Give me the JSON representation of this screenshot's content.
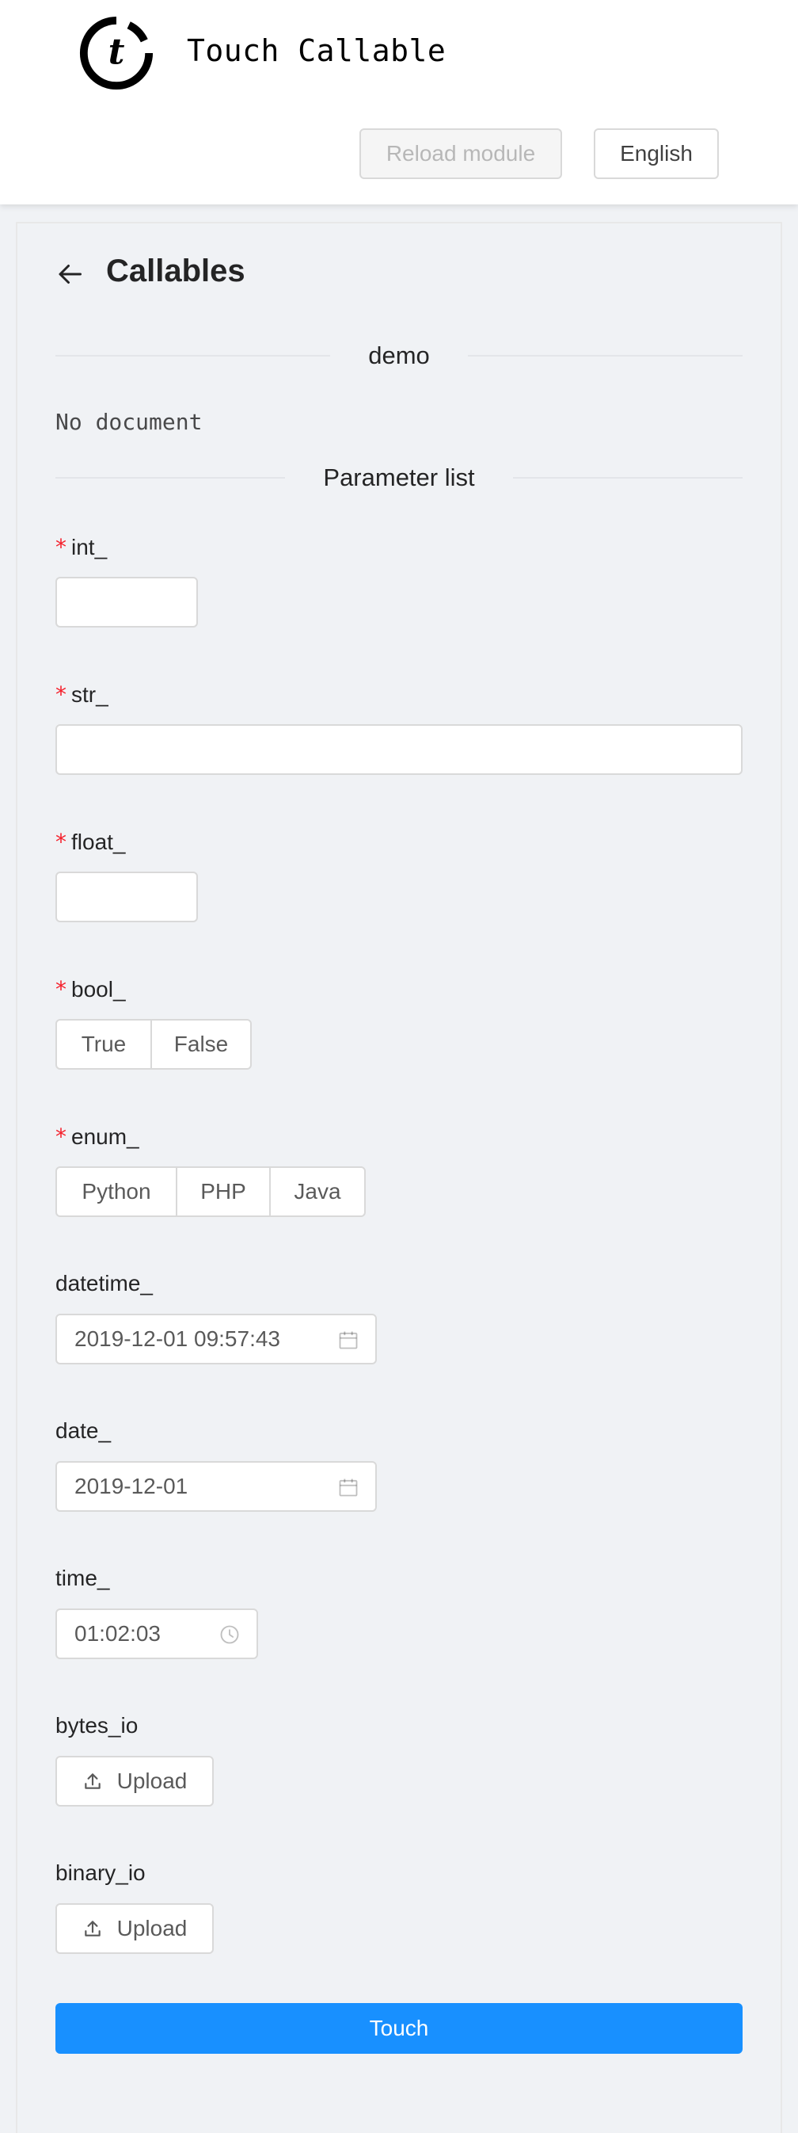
{
  "header": {
    "app_title": "Touch Callable",
    "reload_label": "Reload module",
    "language_label": "English"
  },
  "card": {
    "title": "Callables",
    "callable_name": "demo",
    "document": "No document",
    "param_section": "Parameter list"
  },
  "fields": {
    "int": {
      "label": "int_",
      "required": "*",
      "value": ""
    },
    "str": {
      "label": "str_",
      "required": "*",
      "value": ""
    },
    "float": {
      "label": "float_",
      "required": "*",
      "value": ""
    },
    "bool": {
      "label": "bool_",
      "required": "*",
      "options": [
        "True",
        "False"
      ]
    },
    "enum": {
      "label": "enum_",
      "required": "*",
      "options": [
        "Python",
        "PHP",
        "Java"
      ]
    },
    "datetime": {
      "label": "datetime_",
      "value": "2019-12-01 09:57:43"
    },
    "date": {
      "label": "date_",
      "value": "2019-12-01"
    },
    "time": {
      "label": "time_",
      "value": "01:02:03"
    },
    "bytes_io": {
      "label": "bytes_io",
      "button": "Upload"
    },
    "binary_io": {
      "label": "binary_io",
      "button": "Upload"
    }
  },
  "submit_label": "Touch",
  "icons": {
    "logo": "touch-callable-logo",
    "back": "arrow-left-icon",
    "calendar": "calendar-icon",
    "clock": "clock-icon",
    "upload": "upload-icon"
  },
  "colors": {
    "primary": "#1890ff",
    "required": "#f5222d",
    "background": "#f0f2f5"
  }
}
